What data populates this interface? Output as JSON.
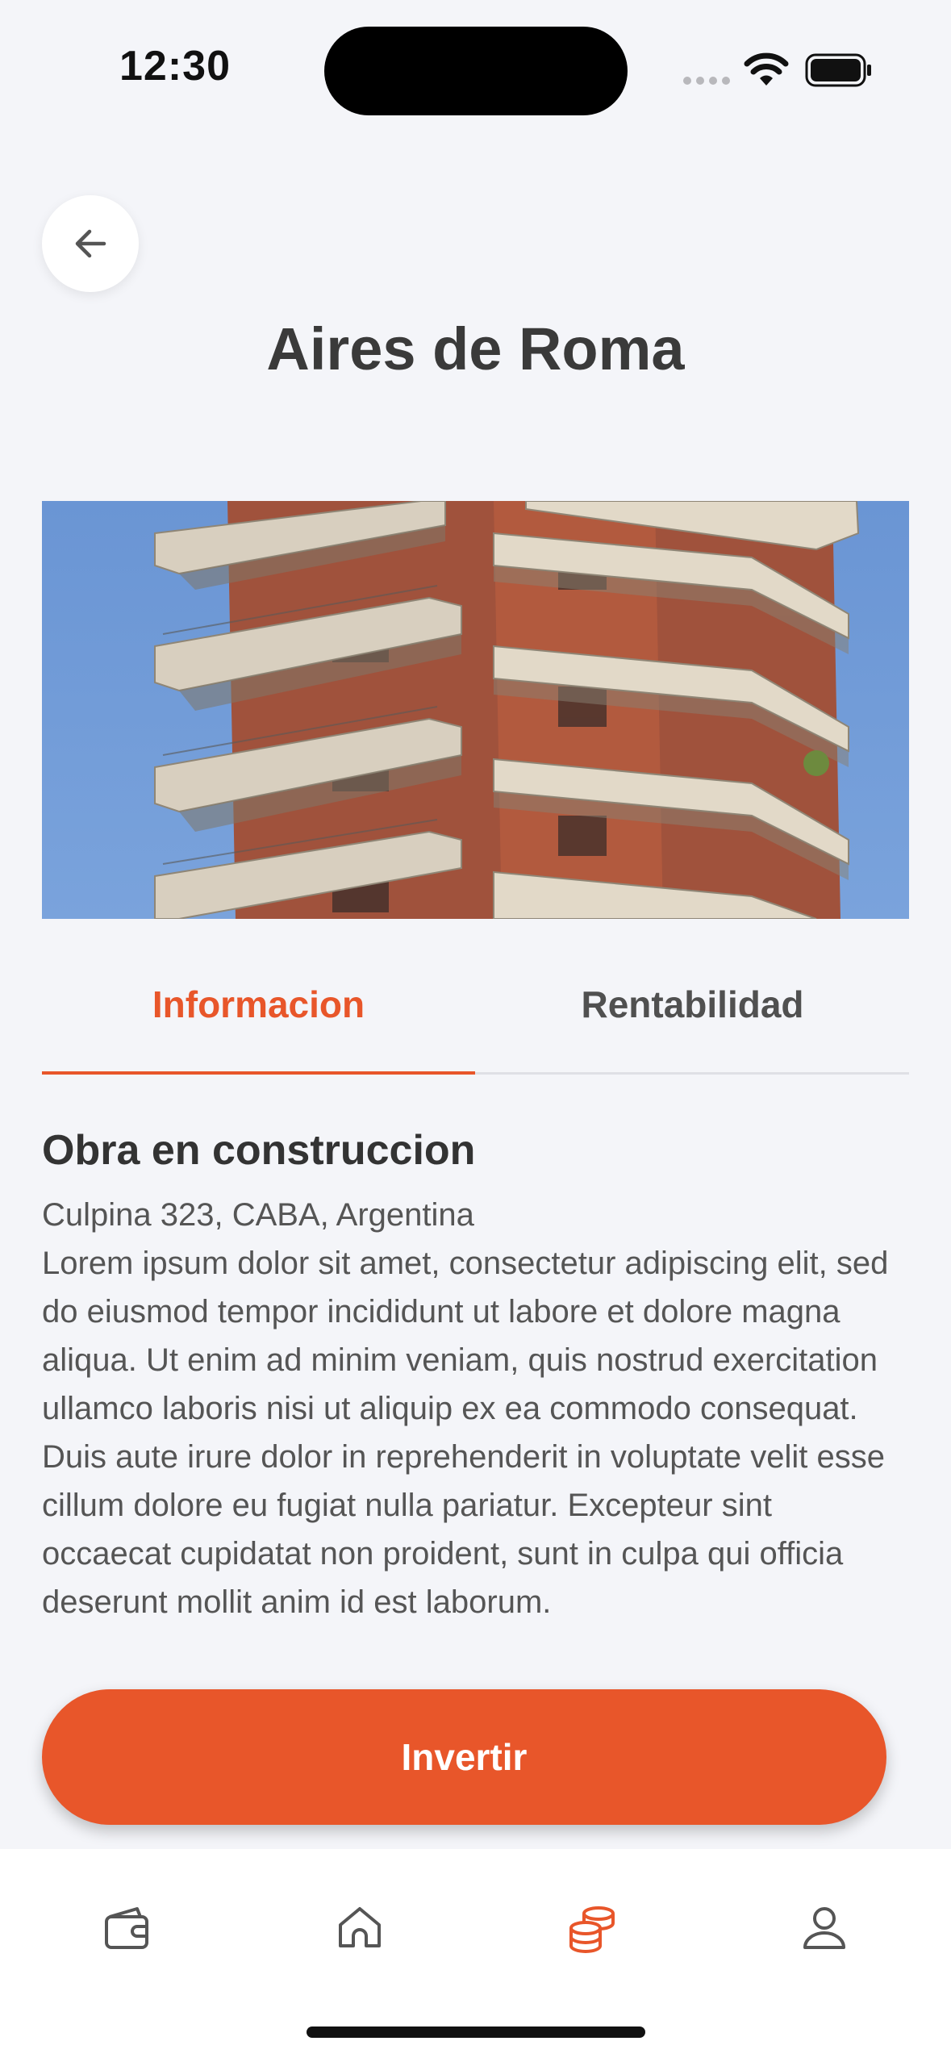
{
  "status_bar": {
    "time": "12:30"
  },
  "header": {
    "title": "Aires de Roma",
    "back_icon": "arrow-left-icon"
  },
  "tabs": [
    {
      "label": "Informacion",
      "active": true
    },
    {
      "label": "Rentabilidad",
      "active": false
    }
  ],
  "content": {
    "section_title": "Obra en construccion",
    "address": "Culpina 323, CABA, Argentina",
    "description": "Lorem ipsum dolor sit amet, consectetur adipiscing elit, sed do eiusmod tempor incididunt ut labore et dolore magna aliqua. Ut enim ad minim veniam, quis nostrud exercitation ullamco laboris nisi ut aliquip ex ea commodo consequat. Duis aute irure dolor in reprehenderit in voluptate velit esse cillum dolore eu fugiat nulla pariatur. Excepteur sint occaecat cupidatat non proident, sunt in culpa qui officia deserunt mollit anim id est laborum."
  },
  "actions": {
    "invest_label": "Invertir"
  },
  "bottom_nav": {
    "items": [
      {
        "icon": "wallet-icon",
        "active": false
      },
      {
        "icon": "home-icon",
        "active": false
      },
      {
        "icon": "coins-icon",
        "active": true
      },
      {
        "icon": "user-icon",
        "active": false
      }
    ]
  },
  "colors": {
    "accent": "#e8562a",
    "background": "#f4f5f9",
    "text": "#3a3a3a",
    "icon_inactive": "#555555"
  }
}
